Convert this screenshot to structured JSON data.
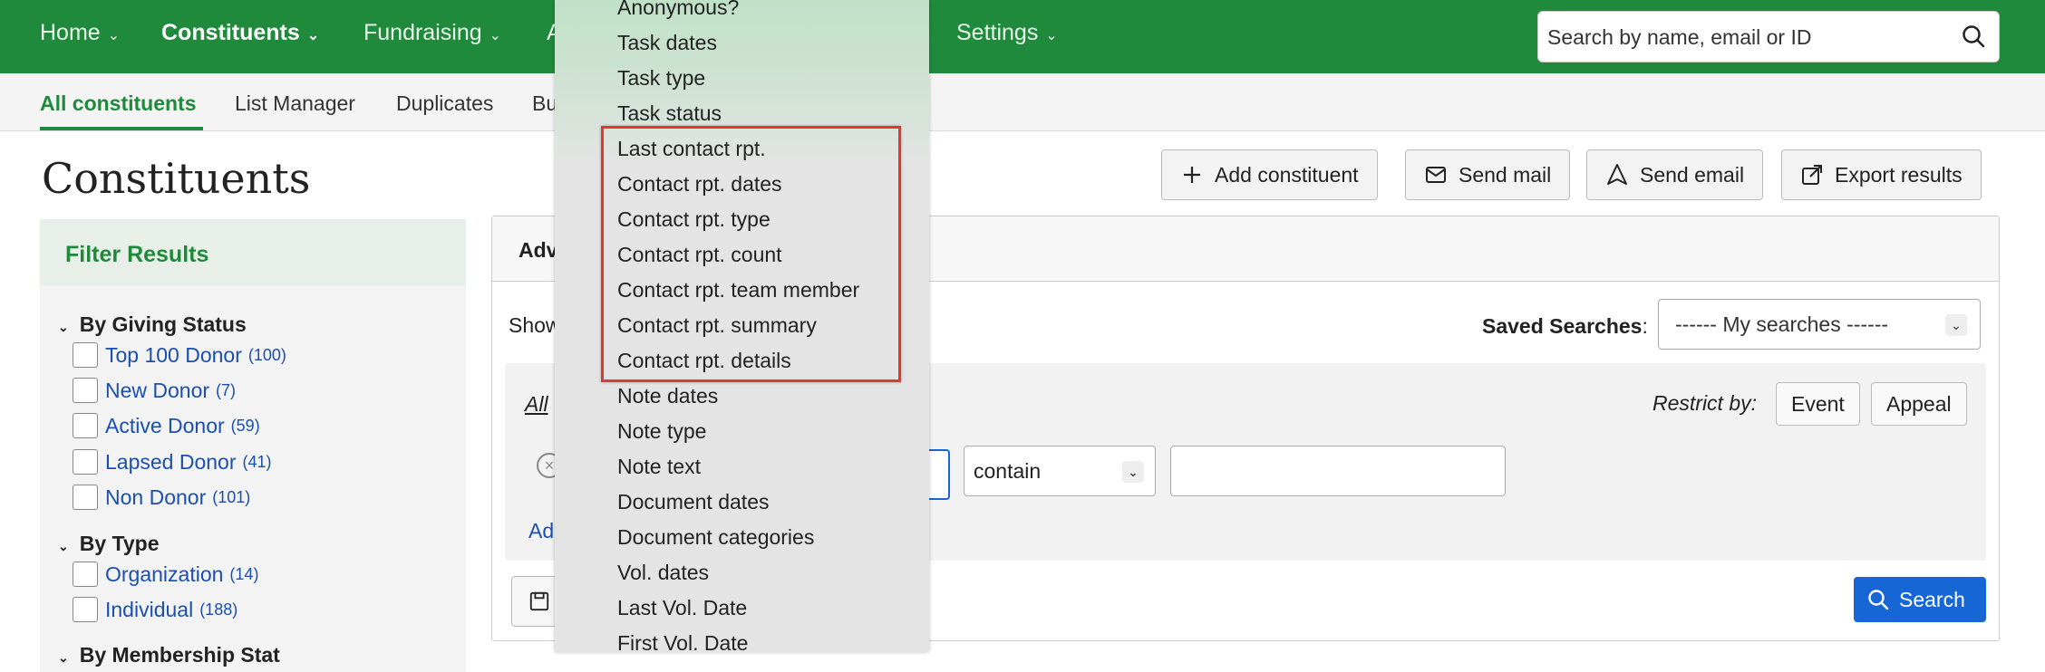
{
  "topnav": {
    "items": [
      {
        "label": "Home",
        "chevron": "⌄"
      },
      {
        "label": "Constituents",
        "chevron": "⌄"
      },
      {
        "label": "Fundraising",
        "chevron": "⌄"
      },
      {
        "label": "A"
      },
      {
        "label": "Settings",
        "chevron": "⌄"
      }
    ],
    "search_placeholder": "Search by name, email or ID",
    "search_icon": "search-icon"
  },
  "subnav": {
    "tabs": [
      "All constituents",
      "List Manager",
      "Duplicates",
      "Bu"
    ]
  },
  "page": {
    "title": "Constituents",
    "actions": [
      {
        "label": "Add constituent",
        "icon": "plus-icon"
      },
      {
        "label": "Send mail",
        "icon": "mail-icon"
      },
      {
        "label": "Send email",
        "icon": "send-icon"
      },
      {
        "label": "Export results",
        "icon": "export-icon"
      }
    ]
  },
  "sidebar": {
    "heading": "Filter Results",
    "groups": [
      {
        "title": "By Giving Status",
        "options": [
          {
            "label": "Top 100 Donor",
            "count": "(100)"
          },
          {
            "label": "New Donor",
            "count": "(7)"
          },
          {
            "label": "Active Donor",
            "count": "(59)"
          },
          {
            "label": "Lapsed Donor",
            "count": "(41)"
          },
          {
            "label": "Non Donor",
            "count": "(101)"
          }
        ]
      },
      {
        "title": "By Type",
        "options": [
          {
            "label": "Organization",
            "count": "(14)"
          },
          {
            "label": "Individual",
            "count": "(188)"
          }
        ]
      },
      {
        "title": "By Membership Stat"
      }
    ]
  },
  "panel": {
    "head_cut": "Adv",
    "show_cut": "Show",
    "all_cut": "All",
    "add_cut": "Ad",
    "saved_label": "Saved Searches",
    "saved_colon": ":",
    "saved_value": "------ My searches ------",
    "restrict_label": "Restrict by:",
    "restrict_buttons": [
      "Event",
      "Appeal"
    ],
    "operator": "contain",
    "search_button": "Search"
  },
  "dropdown": {
    "items": [
      "Anonymous?",
      "Task dates",
      "Task type",
      "Task status",
      "Last contact rpt.",
      "Contact rpt. dates",
      "Contact rpt. type",
      "Contact rpt. count",
      "Contact rpt. team member",
      "Contact rpt. summary",
      "Contact rpt. details",
      "Note dates",
      "Note type",
      "Note text",
      "Document dates",
      "Document categories",
      "Vol. dates",
      "Last Vol. Date",
      "First Vol. Date"
    ]
  },
  "colors": {
    "brand": "#1f8a3b",
    "highlight": "#e03a2e",
    "search_button": "#1666d6"
  }
}
